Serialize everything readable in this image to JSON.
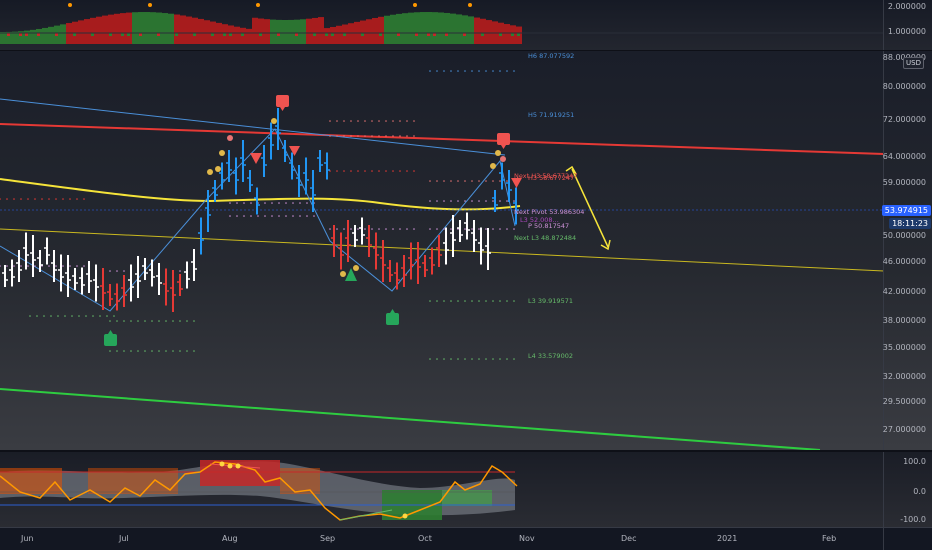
{
  "top_axis": {
    "labels": [
      "2.000000",
      "1.000000"
    ]
  },
  "main_axis": {
    "currency_badge": "USD",
    "labels": [
      "88.000000",
      "80.000000",
      "72.000000",
      "64.000000",
      "59.000000",
      "53.000000",
      "50.000000",
      "46.000000",
      "42.000000",
      "38.000000",
      "35.000000",
      "32.000000",
      "29.500000",
      "27.000000"
    ],
    "last_price": "53.974915",
    "countdown": "18:11:23"
  },
  "osc_axis": {
    "labels": [
      "100.0",
      "0.0",
      "-100.0"
    ]
  },
  "time_axis": {
    "labels": [
      "Jun",
      "Jul",
      "Aug",
      "Sep",
      "Oct",
      "Nov",
      "Dec",
      "2021",
      "Feb"
    ]
  },
  "pivots": {
    "h6": "H6 87.077592",
    "h5": "H5 71.919251",
    "h3_next": "Next H3 58.677247",
    "h3": "H3 58.677247",
    "pivot_next": "Next Pivot 53.986304",
    "l3_small": "L3 52.008...",
    "p": "P 50.817547",
    "l3_next": "Next L3 48.872484",
    "l3": "L3 39.919571",
    "l4": "L4 33.579002"
  },
  "colors": {
    "accent_blue": "#2962ff",
    "upper_channel": "#e53935",
    "lower_channel": "#2ecc40",
    "mid_line": "#e6d12a",
    "bull_bar": "#2196f3",
    "bear_bar": "#e53935",
    "neutral_bar": "#ffffff"
  },
  "icons": {
    "sell_signal": "red-flag-icon",
    "buy_signal": "green-flag-icon",
    "down_arrow": "down-triangle-icon",
    "up_arrow": "up-triangle-icon"
  }
}
